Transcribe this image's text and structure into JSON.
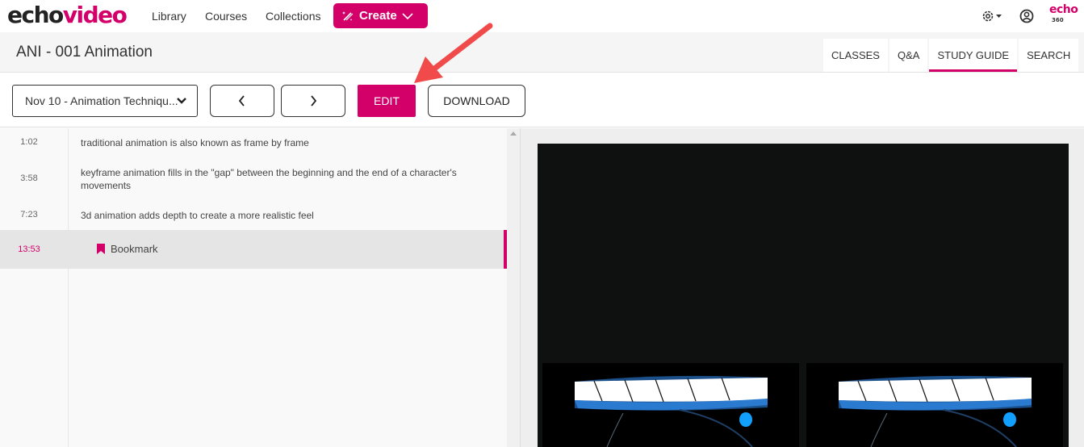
{
  "app": {
    "logo_part1": "echo",
    "logo_part2": "video",
    "brand_color": "#d4006a"
  },
  "nav": {
    "links": [
      "Library",
      "Courses",
      "Collections"
    ],
    "create_label": "Create"
  },
  "top_right": {
    "settings_icon": "gear-icon",
    "user_icon": "user-circle-icon",
    "brand_logo_top": "echo",
    "brand_logo_bottom": "360"
  },
  "header": {
    "title": "ANI - 001 Animation",
    "tabs": [
      {
        "label": "CLASSES",
        "active": false
      },
      {
        "label": "Q&A",
        "active": false
      },
      {
        "label": "STUDY GUIDE",
        "active": true
      },
      {
        "label": "SEARCH",
        "active": false
      }
    ]
  },
  "toolbar": {
    "class_select_value": "Nov 10 - Animation Techniqu...",
    "prev_icon": "chevron-left-icon",
    "next_icon": "chevron-right-icon",
    "edit_label": "EDIT",
    "download_label": "DOWNLOAD"
  },
  "notes": [
    {
      "time": "1:02",
      "text": "traditional animation is also known as frame by frame",
      "type": "note",
      "active": false
    },
    {
      "time": "3:58",
      "text": "keyframe animation fills in the \"gap\" between the beginning and the end of a character's movements",
      "type": "note",
      "active": false
    },
    {
      "time": "7:23",
      "text": "3d animation adds depth to create a more realistic feel",
      "type": "note",
      "active": false
    },
    {
      "time": "13:53",
      "text": "Bookmark",
      "type": "bookmark",
      "active": true
    }
  ],
  "annotation": {
    "arrow_color": "#f04a4a",
    "points_to": "edit-button"
  }
}
